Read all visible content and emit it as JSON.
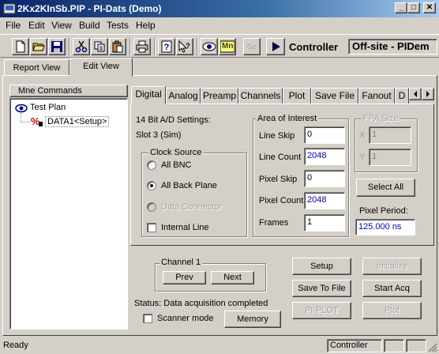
{
  "window": {
    "title": "2Kx2KInSb.PIP - PI-Dats (Demo)",
    "min_glyph": "_",
    "max_glyph": "□",
    "close_glyph": "✕"
  },
  "menu": [
    "File",
    "Edit",
    "View",
    "Build",
    "Tests",
    "Help"
  ],
  "toolbar": {
    "icons": [
      "new-file-icon",
      "open-folder-icon",
      "save-disk-icon",
      "cut-icon",
      "copy-icon",
      "paste-icon",
      "print-icon",
      "help-icon",
      "context-help-icon",
      "view-eye-icon",
      "mn-icon",
      "go-icon",
      "play-icon"
    ],
    "mn_label": "Mn",
    "go_label": "Go",
    "controller_label": "Controller",
    "location": "Off-site - PIDem"
  },
  "outer_tabs": [
    "Report View",
    "Edit View"
  ],
  "tree": {
    "header": "Mne Commands",
    "root": "Test Plan",
    "child": "DATA1<Setup>"
  },
  "inner_tabs": [
    "Digital",
    "Analog",
    "Preamp",
    "Channels",
    "Plot",
    "Save File",
    "Fanout",
    "D"
  ],
  "digital": {
    "ad_settings": "14 Bit A/D Settings:",
    "slot": "Slot 3 (Sim)",
    "clock_source": {
      "title": "Clock Source",
      "options": [
        "All BNC",
        "All Back Plane",
        "Data Connector"
      ],
      "selected": "All Back Plane",
      "internal_line": "Internal Line"
    },
    "aoi": {
      "title": "Area of Interest",
      "line_skip_label": "Line Skip",
      "line_skip": "0",
      "line_count_label": "Line Count",
      "line_count": "2048",
      "pixel_skip_label": "Pixel Skip",
      "pixel_skip": "0",
      "pixel_count_label": "Pixel Count",
      "pixel_count": "2048",
      "frames_label": "Frames",
      "frames": "1"
    },
    "fpa": {
      "title": "FPA Size",
      "x_label": "X",
      "x": "1",
      "y_label": "Y",
      "y": "1"
    },
    "select_all": "Select All",
    "pixel_period_label": "Pixel Period:",
    "pixel_period": "125.000 ns"
  },
  "bottom": {
    "channel_title": "Channel 1",
    "prev": "Prev",
    "next": "Next",
    "status": "Status: Data acquisition completed",
    "scanner_mode": "Scanner mode",
    "memory": "Memory",
    "setup": "Setup",
    "initialize": "Initialize",
    "save_to_file": "Save To File",
    "start_acq": "Start Acq",
    "pi_plot": "PI-PLOT",
    "plot": "Plot"
  },
  "statusbar": {
    "ready": "Ready",
    "controller": "Controller"
  }
}
